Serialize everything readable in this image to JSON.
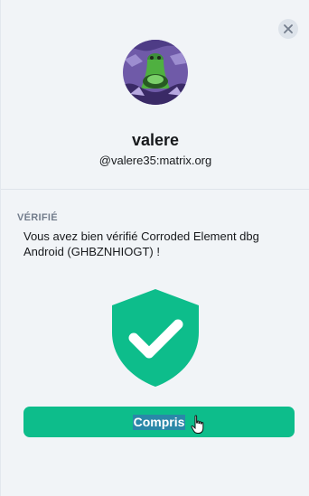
{
  "user": {
    "display_name": "valere",
    "user_id": "@valere35:matrix.org"
  },
  "verification": {
    "heading": "VÉRIFIÉ",
    "message": "Vous avez bien vérifié Corroded Element dbg Android (GHBZNHIOGT) !",
    "status_icon": "shield-check-icon"
  },
  "actions": {
    "done_label": "Compris"
  },
  "icons": {
    "close": "close-icon",
    "cursor": "hand-pointer-icon"
  },
  "colors": {
    "accent": "#0dbd8b",
    "background": "#f1f4f7",
    "text": "#17191c",
    "muted": "#737d8c"
  }
}
